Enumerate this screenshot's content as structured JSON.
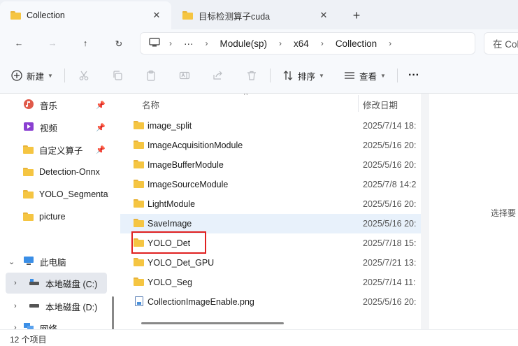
{
  "tabs": [
    {
      "title": "Collection",
      "icon": "folder-icon",
      "active": true
    },
    {
      "title": "目标检测算子cuda",
      "icon": "folder-icon",
      "active": false
    }
  ],
  "tab_close_glyph": "✕",
  "new_tab_glyph": "+",
  "nav_glyphs": {
    "back": "←",
    "forward": "→",
    "up": "↑",
    "refresh": "↻"
  },
  "breadcrumb": [
    "Module(sp)",
    "x64",
    "Collection"
  ],
  "search": {
    "placeholder": "在 Collection 中搜索"
  },
  "commands": {
    "new_label": "新建",
    "sort_label": "排序",
    "view_label": "查看",
    "more_label": "···"
  },
  "nav_items": [
    {
      "label": "音乐",
      "icon": "music-icon",
      "pinned": true
    },
    {
      "label": "视频",
      "icon": "video-icon",
      "pinned": true
    },
    {
      "label": "自定义算子",
      "icon": "folder-icon",
      "pinned": true
    },
    {
      "label": "Detection-Onnx",
      "icon": "folder-icon",
      "pinned": false
    },
    {
      "label": "YOLO_Segmentation",
      "icon": "folder-icon",
      "pinned": false
    },
    {
      "label": "picture",
      "icon": "folder-icon",
      "pinned": false
    },
    {
      "label": "此电脑",
      "icon": "computer-icon",
      "pinned": false
    },
    {
      "label": "本地磁盘 (C:)",
      "icon": "drive-icon",
      "pinned": false
    },
    {
      "label": "本地磁盘 (D:)",
      "icon": "drive-icon",
      "pinned": false
    },
    {
      "label": "网络",
      "icon": "network-icon",
      "pinned": false
    }
  ],
  "columns": {
    "name": "名称",
    "date": "修改日期"
  },
  "files": [
    {
      "name": "image_split",
      "date": "2025/7/14 18:",
      "type": "folder"
    },
    {
      "name": "ImageAcquisitionModule",
      "date": "2025/5/16 20:",
      "type": "folder"
    },
    {
      "name": "ImageBufferModule",
      "date": "2025/5/16 20:",
      "type": "folder"
    },
    {
      "name": "ImageSourceModule",
      "date": "2025/7/8 14:2",
      "type": "folder"
    },
    {
      "name": "LightModule",
      "date": "2025/5/16 20:",
      "type": "folder"
    },
    {
      "name": "SaveImage",
      "date": "2025/5/16 20:",
      "type": "folder"
    },
    {
      "name": "YOLO_Det",
      "date": "2025/7/18 15:",
      "type": "folder"
    },
    {
      "name": "YOLO_Det_GPU",
      "date": "2025/7/21 13:",
      "type": "folder"
    },
    {
      "name": "YOLO_Seg",
      "date": "2025/7/14 11:",
      "type": "folder"
    },
    {
      "name": "CollectionImageEnable.png",
      "date": "2025/5/16 20:",
      "type": "image"
    }
  ],
  "detail_hint": "选择要",
  "status": {
    "item_count": "12 个项目"
  },
  "colors": {
    "accent": "#0067c0",
    "folder": "#f5c542",
    "highlight": "#e02020",
    "hover_row": "#e8f1fb"
  }
}
